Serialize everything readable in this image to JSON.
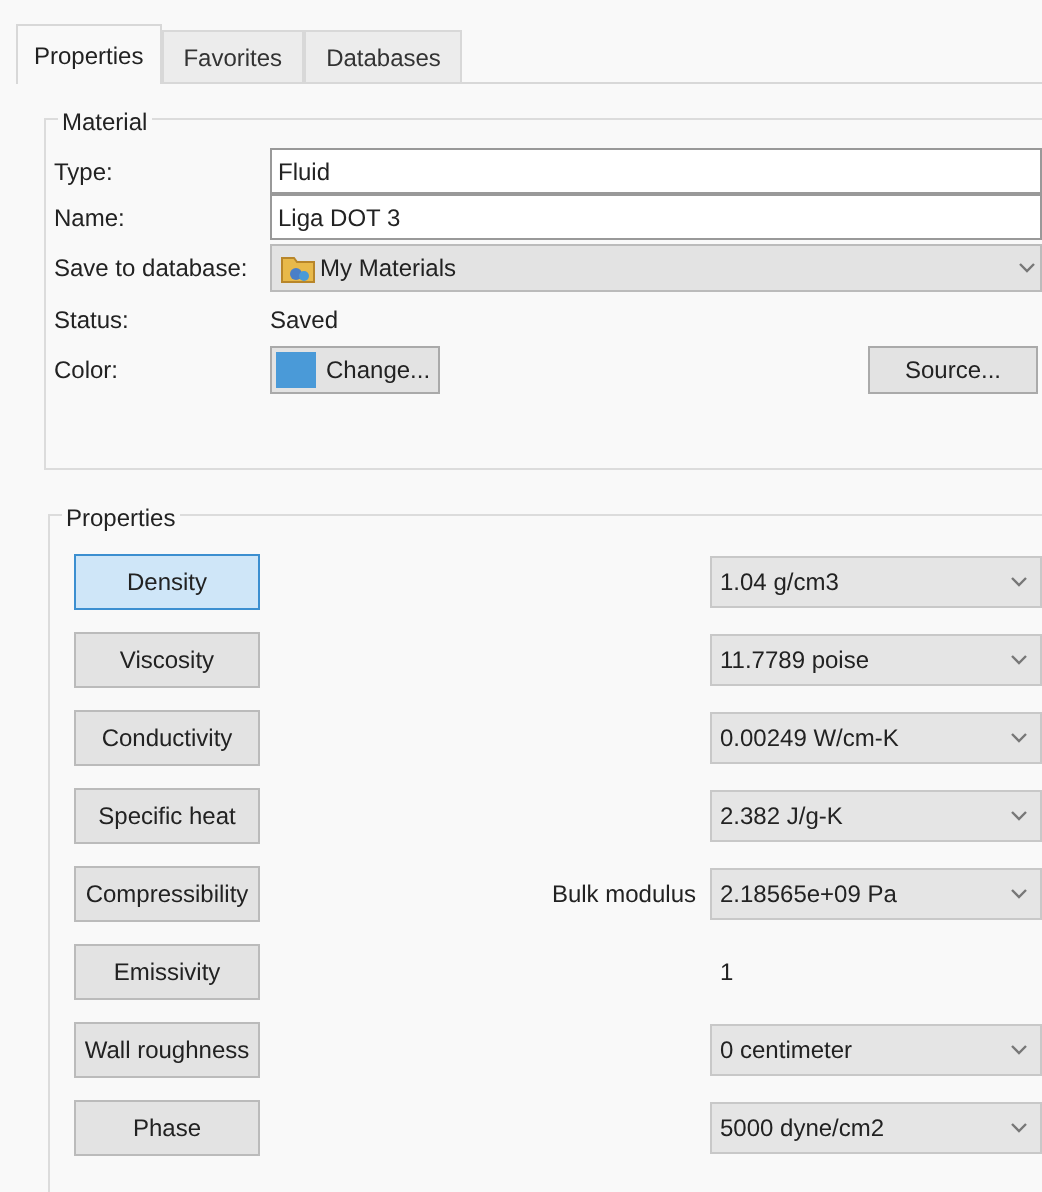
{
  "tabs": [
    {
      "label": "Properties",
      "selected": true
    },
    {
      "label": "Favorites",
      "selected": false
    },
    {
      "label": "Databases",
      "selected": false
    }
  ],
  "material": {
    "title": "Material",
    "type": {
      "label": "Type:",
      "value": "Fluid"
    },
    "name": {
      "label": "Name:",
      "value": "Liga DOT 3"
    },
    "save_to_database": {
      "label": "Save to database:",
      "value": "My Materials"
    },
    "status": {
      "label": "Status:",
      "value": "Saved"
    },
    "color": {
      "label": "Color:",
      "color": "#4a9ad8",
      "button": "Change..."
    },
    "source_button": "Source..."
  },
  "properties": {
    "title": "Properties",
    "rows": [
      {
        "button": "Density",
        "selected": true,
        "kind": "dropdown",
        "value": "1.04 g/cm3"
      },
      {
        "button": "Viscosity",
        "selected": false,
        "kind": "dropdown",
        "value": "11.7789 poise"
      },
      {
        "button": "Conductivity",
        "selected": false,
        "kind": "dropdown",
        "value": "0.00249 W/cm-K"
      },
      {
        "button": "Specific heat",
        "selected": false,
        "kind": "dropdown",
        "value": "2.382 J/g-K"
      },
      {
        "button": "Compressibility",
        "selected": false,
        "kind": "dropdown",
        "prefix": "Bulk modulus",
        "value": "2.18565e+09 Pa"
      },
      {
        "button": "Emissivity",
        "selected": false,
        "kind": "text",
        "value": "1"
      },
      {
        "button": "Wall roughness",
        "selected": false,
        "kind": "dropdown",
        "value": "0 centimeter"
      },
      {
        "button": "Phase",
        "selected": false,
        "kind": "dropdown",
        "value": "5000 dyne/cm2"
      }
    ]
  }
}
